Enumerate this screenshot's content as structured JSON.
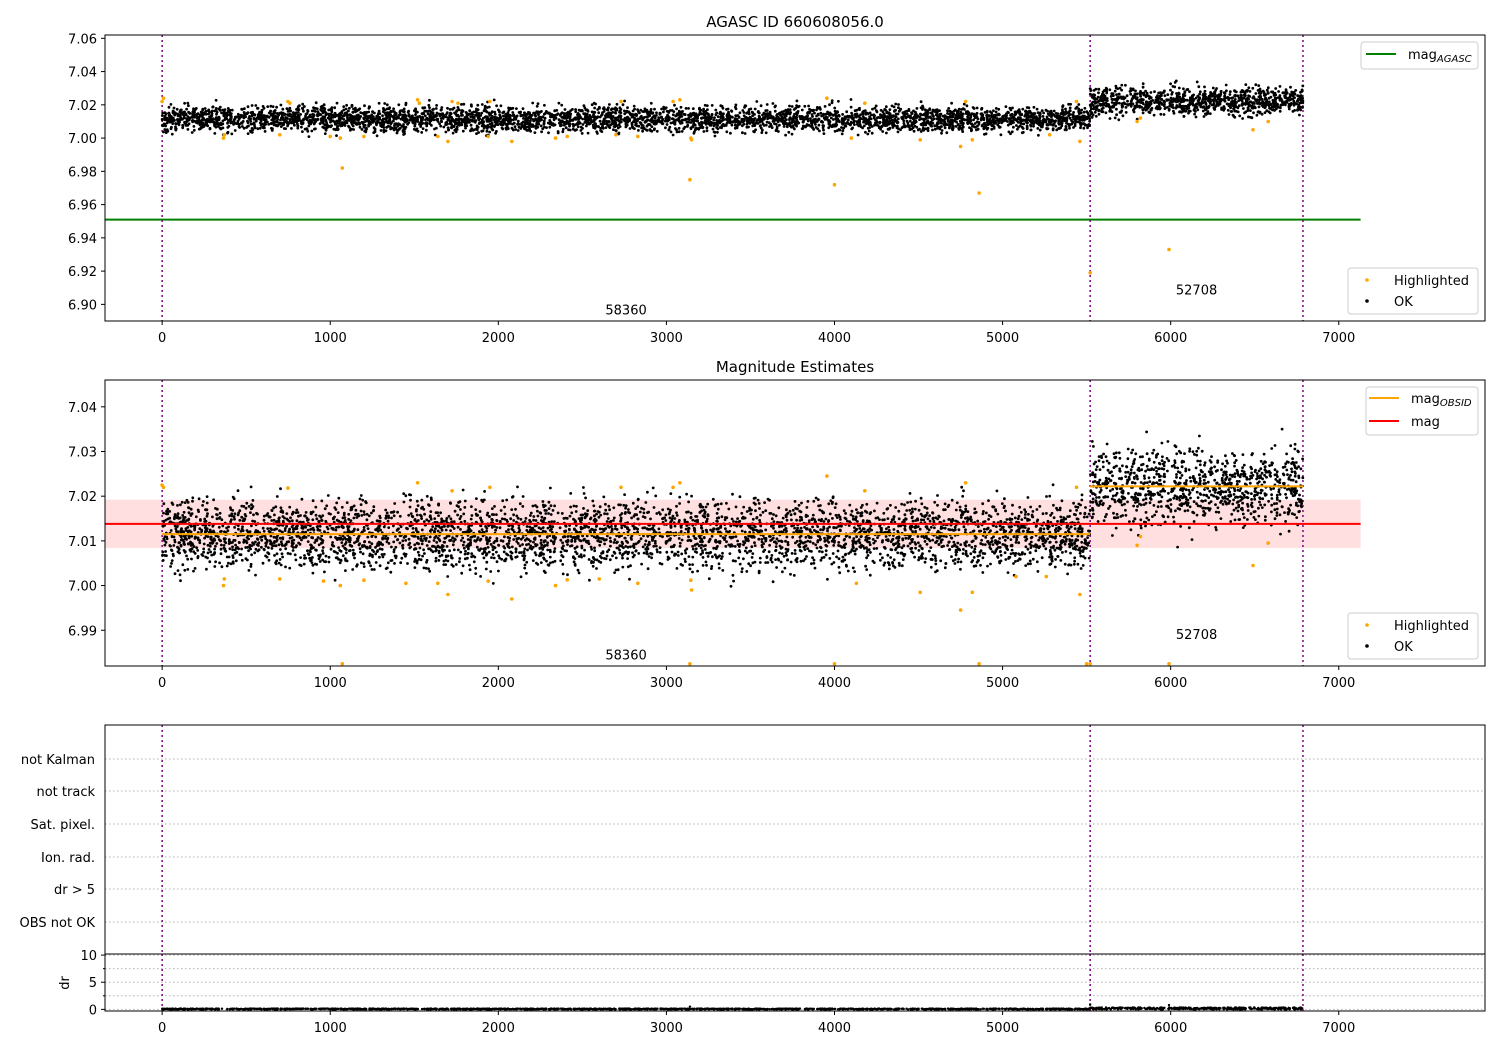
{
  "chart_data": [
    {
      "type": "scatter",
      "title": "AGASC ID 660608056.0",
      "xlim": [
        -340,
        7870
      ],
      "ylim": [
        6.89,
        7.062
      ],
      "xticks": [
        0,
        1000,
        2000,
        3000,
        4000,
        5000,
        6000,
        7000
      ],
      "xtick_labels": [
        "0",
        "1000",
        "2000",
        "3000",
        "4000",
        "5000",
        "6000",
        "7000"
      ],
      "yticks": [
        6.9,
        6.92,
        6.94,
        6.96,
        6.98,
        7.0,
        7.02,
        7.04,
        7.06
      ],
      "ytick_labels": [
        "6.90",
        "6.92",
        "6.94",
        "6.96",
        "6.98",
        "7.00",
        "7.02",
        "7.04",
        "7.06"
      ],
      "vlines": [
        0,
        5521,
        6787
      ],
      "segment_labels": [
        {
          "text": "58360",
          "x": 2760,
          "y": 6.894
        },
        {
          "text": "52708",
          "x": 6154,
          "y": 6.906
        }
      ],
      "hlines": [
        {
          "name": "mag_AGASC",
          "y": 6.951,
          "x0": -340,
          "x1": 7130,
          "color": "#008000"
        }
      ],
      "ok_segments": [
        {
          "x0": 0,
          "x1": 5521,
          "mean": 7.0115,
          "spread": 0.0085
        },
        {
          "x0": 5521,
          "x1": 6787,
          "mean": 7.0222,
          "spread": 0.0095
        }
      ],
      "highlighted_points": [
        [
          0,
          7.022
        ],
        [
          8,
          7.024
        ],
        [
          365,
          7.0
        ],
        [
          370,
          7.002
        ],
        [
          700,
          7.002
        ],
        [
          748,
          7.022
        ],
        [
          760,
          7.021
        ],
        [
          1000,
          7.001
        ],
        [
          1060,
          7.0
        ],
        [
          1072,
          6.982
        ],
        [
          1200,
          7.001
        ],
        [
          1520,
          7.023
        ],
        [
          1530,
          7.021
        ],
        [
          1640,
          7.001
        ],
        [
          1700,
          6.998
        ],
        [
          1725,
          7.022
        ],
        [
          1760,
          7.021
        ],
        [
          1940,
          7.001
        ],
        [
          1950,
          7.022
        ],
        [
          2080,
          6.998
        ],
        [
          2340,
          7.0
        ],
        [
          2410,
          7.001
        ],
        [
          2700,
          7.002
        ],
        [
          2730,
          7.022
        ],
        [
          2830,
          7.001
        ],
        [
          3040,
          7.022
        ],
        [
          3080,
          7.023
        ],
        [
          3140,
          6.975
        ],
        [
          3145,
          7.0
        ],
        [
          3150,
          6.999
        ],
        [
          3955,
          7.024
        ],
        [
          4000,
          6.972
        ],
        [
          4100,
          7.0
        ],
        [
          4180,
          7.021
        ],
        [
          4510,
          6.999
        ],
        [
          4750,
          6.995
        ],
        [
          4780,
          7.022
        ],
        [
          4820,
          6.999
        ],
        [
          4860,
          6.967
        ],
        [
          5280,
          7.002
        ],
        [
          5440,
          7.022
        ],
        [
          5460,
          6.998
        ],
        [
          5521,
          6.919
        ],
        [
          5800,
          7.01
        ],
        [
          5820,
          7.012
        ],
        [
          5990,
          6.933
        ],
        [
          6490,
          7.005
        ],
        [
          6580,
          7.01
        ]
      ],
      "legends": [
        {
          "placement": "upper right",
          "entries": [
            {
              "label": "mag",
              "subscript": "AGASC",
              "marker": "line",
              "color": "#008000"
            }
          ]
        },
        {
          "placement": "lower right",
          "entries": [
            {
              "label": "Highlighted",
              "marker": "dot",
              "color": "#ffa500"
            },
            {
              "label": "OK",
              "marker": "dot",
              "color": "#000000"
            }
          ]
        }
      ]
    },
    {
      "type": "scatter",
      "title": "Magnitude Estimates",
      "xlim": [
        -340,
        7870
      ],
      "ylim": [
        6.982,
        7.046
      ],
      "xticks": [
        0,
        1000,
        2000,
        3000,
        4000,
        5000,
        6000,
        7000
      ],
      "xtick_labels": [
        "0",
        "1000",
        "2000",
        "3000",
        "4000",
        "5000",
        "6000",
        "7000"
      ],
      "yticks": [
        6.99,
        7.0,
        7.01,
        7.02,
        7.03,
        7.04
      ],
      "ytick_labels": [
        "6.99",
        "7.00",
        "7.01",
        "7.02",
        "7.03",
        "7.04"
      ],
      "vlines": [
        0,
        5521,
        6787
      ],
      "segment_labels": [
        {
          "text": "58360",
          "x": 2760,
          "y": 6.9835
        },
        {
          "text": "52708",
          "x": 6154,
          "y": 6.988
        }
      ],
      "band": {
        "y0": 7.0084,
        "y1": 7.0192,
        "x0": -340,
        "x1": 7130,
        "color": "#ffb0b0"
      },
      "hlines": [
        {
          "name": "mag",
          "y": 7.0138,
          "x0": -340,
          "x1": 7130,
          "color": "#ff0000"
        },
        {
          "name": "mag_OBSID_seg1",
          "y": 7.0115,
          "x0": 0,
          "x1": 5521,
          "color": "#ffa500"
        },
        {
          "name": "mag_OBSID_seg2",
          "y": 7.0222,
          "x0": 5521,
          "x1": 6787,
          "color": "#ffa500"
        }
      ],
      "ok_segments": [
        {
          "x0": 0,
          "x1": 5521,
          "mean": 7.0115,
          "spread": 0.0085
        },
        {
          "x0": 5521,
          "x1": 6787,
          "mean": 7.0222,
          "spread": 0.0095
        }
      ],
      "highlighted_points": [
        [
          0,
          7.0225
        ],
        [
          8,
          7.022
        ],
        [
          365,
          7.0
        ],
        [
          370,
          7.0015
        ],
        [
          700,
          7.0015
        ],
        [
          748,
          7.0218
        ],
        [
          960,
          7.001
        ],
        [
          1060,
          7.0
        ],
        [
          1072,
          6.9825
        ],
        [
          1200,
          7.0012
        ],
        [
          1450,
          7.0005
        ],
        [
          1520,
          7.023
        ],
        [
          1640,
          7.0005
        ],
        [
          1700,
          6.998
        ],
        [
          1725,
          7.0212
        ],
        [
          1940,
          7.001
        ],
        [
          1950,
          7.022
        ],
        [
          2080,
          6.997
        ],
        [
          2340,
          7.0
        ],
        [
          2410,
          7.0013
        ],
        [
          2600,
          7.0015
        ],
        [
          2730,
          7.022
        ],
        [
          2830,
          7.0005
        ],
        [
          3040,
          7.022
        ],
        [
          3080,
          7.023
        ],
        [
          3140,
          6.9825
        ],
        [
          3145,
          7.0012
        ],
        [
          3150,
          6.999
        ],
        [
          3955,
          7.0245
        ],
        [
          4000,
          6.9825
        ],
        [
          4130,
          7.0005
        ],
        [
          4180,
          7.0212
        ],
        [
          4510,
          6.9985
        ],
        [
          4750,
          6.9945
        ],
        [
          4780,
          7.023
        ],
        [
          4820,
          6.9985
        ],
        [
          4860,
          6.9825
        ],
        [
          5080,
          7.002
        ],
        [
          5260,
          7.002
        ],
        [
          5440,
          7.022
        ],
        [
          5460,
          6.998
        ],
        [
          5500,
          6.9825
        ],
        [
          5521,
          6.9825
        ],
        [
          5800,
          7.009
        ],
        [
          5820,
          7.011
        ],
        [
          5990,
          6.9825
        ],
        [
          6490,
          7.0045
        ],
        [
          6580,
          7.0095
        ]
      ],
      "legends": [
        {
          "placement": "upper right",
          "entries": [
            {
              "label": "mag",
              "subscript": "OBSID",
              "marker": "line",
              "color": "#ffa500"
            },
            {
              "label": "mag",
              "marker": "line",
              "color": "#ff0000"
            }
          ]
        },
        {
          "placement": "lower right",
          "entries": [
            {
              "label": "Highlighted",
              "marker": "dot",
              "color": "#ffa500"
            },
            {
              "label": "OK",
              "marker": "dot",
              "color": "#000000"
            }
          ]
        }
      ]
    },
    {
      "type": "scatter",
      "title": "",
      "xlim": [
        -340,
        7870
      ],
      "categories": [
        "not Kalman",
        "not track",
        "Sat. pixel.",
        "Ion. rad.",
        "dr > 5",
        "OBS not OK"
      ],
      "vlines": [
        0,
        5521,
        6787
      ],
      "flagged_points": []
    },
    {
      "type": "scatter",
      "title": "",
      "ylabel": "dr",
      "xlim": [
        -340,
        7870
      ],
      "ylim": [
        -0.3,
        10.2
      ],
      "xticks": [
        0,
        1000,
        2000,
        3000,
        4000,
        5000,
        6000,
        7000
      ],
      "xtick_labels": [
        "0",
        "1000",
        "2000",
        "3000",
        "4000",
        "5000",
        "6000",
        "7000"
      ],
      "yticks": [
        0,
        5,
        10
      ],
      "ytick_labels": [
        "0",
        "5",
        "10"
      ],
      "vlines": [
        0,
        5521,
        6787
      ],
      "dr_segments": [
        {
          "x0": 0,
          "x1": 5521,
          "max": 0.15
        },
        {
          "x0": 5521,
          "x1": 6787,
          "max": 0.35
        }
      ]
    }
  ]
}
